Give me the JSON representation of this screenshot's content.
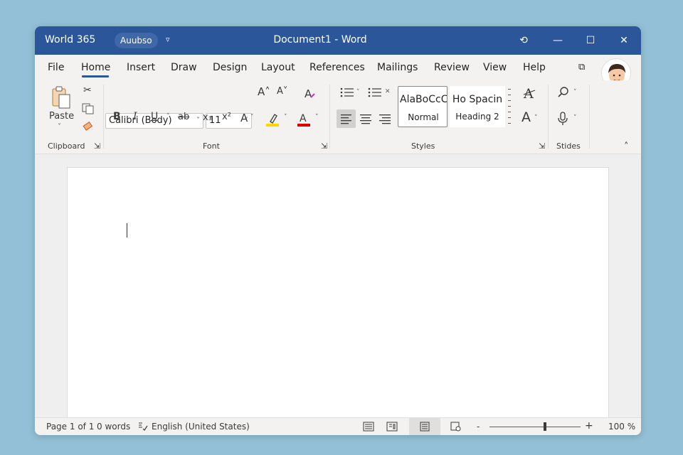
{
  "titlebar": {
    "app_name": "World 365",
    "autosave": "Auubso",
    "dropdown": "▿",
    "doc_title": "Document1 - Word",
    "sync_icon": "⟲",
    "minimize": "—",
    "maximize": "☐",
    "close": "✕"
  },
  "menu": {
    "items": [
      "File",
      "Home",
      "Insert",
      "Draw",
      "Design",
      "Layout",
      "References",
      "Mailings",
      "Review",
      "View",
      "Help"
    ],
    "active": "Home",
    "share_icon": "⧉"
  },
  "ribbon": {
    "clipboard": {
      "label": "Clipboard",
      "paste": "Paste",
      "launcher": "⇲"
    },
    "font": {
      "label": "Font",
      "family": "Calibri (Body)",
      "size": "11",
      "grow": "A˄",
      "shrink": "A˅",
      "bold": "B",
      "italic": "I",
      "underline": "U",
      "strike": "ab",
      "subscript": "x₃",
      "superscript": "x²",
      "effects": "A",
      "highlight_color": "#ffd700",
      "font_color": "#e00000",
      "launcher": "⇲"
    },
    "paragraph": {
      "bullets": "☰",
      "numbering": "☰"
    },
    "styles": {
      "label": "Styles",
      "style1_preview": "AlaBoCcC",
      "style1_name": "Normal",
      "style2_preview": "Ho Spacin",
      "style2_name": "Heading 2",
      "launcher": "⇲"
    },
    "editing": {
      "label": "Stides"
    },
    "collapse": "˄"
  },
  "statusbar": {
    "page": "Page 1 of 1",
    "words": "0 words",
    "language": "English (United States)",
    "zoom_minus": "-",
    "zoom_plus": "+",
    "zoom": "100 %"
  }
}
